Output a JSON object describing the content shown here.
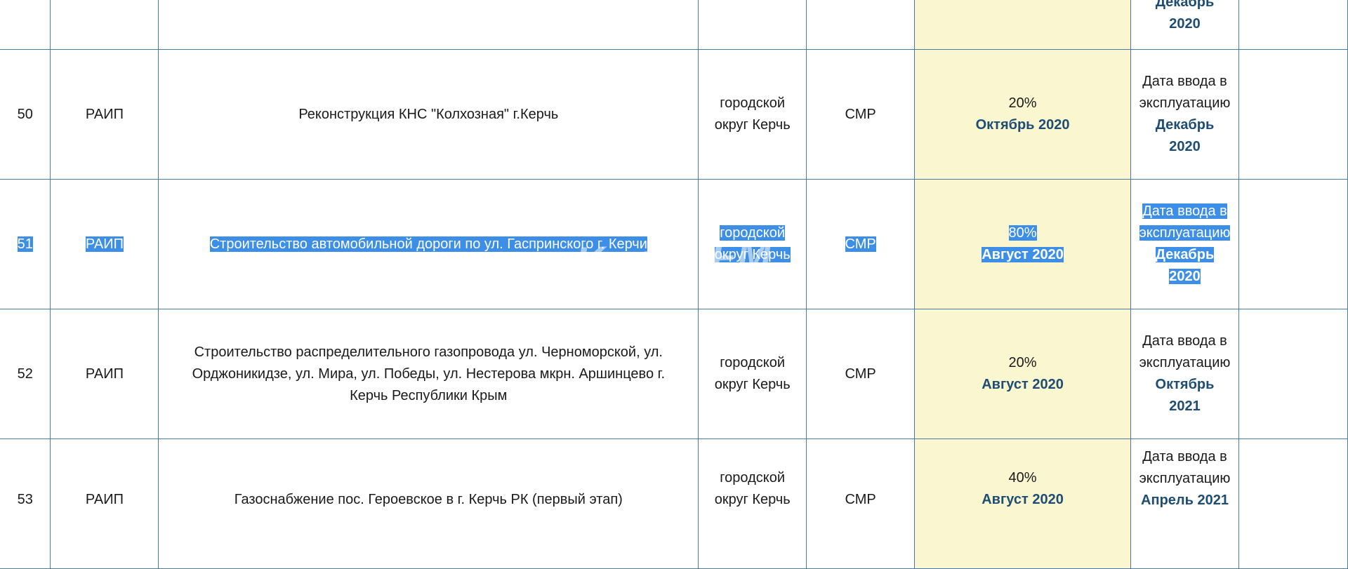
{
  "top_row": {
    "launch_month": "Декабрь",
    "launch_year": "2020"
  },
  "rows": [
    {
      "num": "50",
      "program": "РАИП",
      "object": "Реконструкция КНС \"Колхозная\" г.Керчь",
      "district_l1": "городской",
      "district_l2": "округ Керчь",
      "work_type": "СМР",
      "readiness": "20%",
      "readiness_date": "Октябрь 2020",
      "launch_l1": "Дата ввода в",
      "launch_l2": "эксплуатацию",
      "launch_month": "Декабрь",
      "launch_year": "2020"
    },
    {
      "num": "51",
      "program": "РАИП",
      "object": "Строительство автомобильной дороги по ул. Гаспринского г. Керчи",
      "district_l1": "городской",
      "district_l2": "округ Керчь",
      "work_type": "СМР",
      "readiness": "80%",
      "readiness_date": "Август 2020",
      "launch_l1": "Дата ввода в",
      "launch_l2": "эксплуатацию",
      "launch_month": "Декабрь",
      "launch_year": "2020"
    },
    {
      "num": "52",
      "program": "РАИП",
      "object_l1": "Строительство распределительного газопровода ул. Черноморской, ул.",
      "object_l2": "Орджоникидзе, ул. Мира, ул. Победы, ул. Нестерова мкрн. Аршинцево г.",
      "object_l3": "Керчь Республики Крым",
      "district_l1": "городской",
      "district_l2": "округ Керчь",
      "work_type": "СМР",
      "readiness": "20%",
      "readiness_date": "Август 2020",
      "launch_l1": "Дата ввода в",
      "launch_l2": "эксплуатацию",
      "launch_month": "Октябрь",
      "launch_year": "2021"
    },
    {
      "num": "53",
      "program": "РАИП",
      "object": "Газоснабжение пос. Героевское в г. Керчь РК (первый этап)",
      "district_l1": "городской",
      "district_l2": "округ Керчь",
      "work_type": "СМР",
      "readiness": "40%",
      "readiness_date": "Август 2020",
      "launch_l1": "Дата ввода в",
      "launch_l2": "эксплуатацию",
      "launch_month": "Апрель 2021"
    }
  ],
  "watermark": "Kerch.FM"
}
